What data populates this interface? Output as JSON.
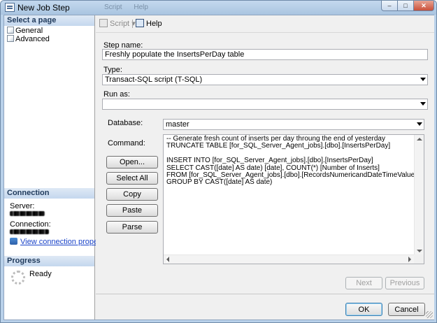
{
  "window": {
    "title": "New Job Step",
    "ghost_tabs": [
      "Script",
      "Help"
    ],
    "min_label": "–",
    "max_label": "□",
    "close_label": "✕"
  },
  "left_pane": {
    "select_page_header": "Select a page",
    "pages": [
      {
        "label": "General",
        "icon": "property-page-icon"
      },
      {
        "label": "Advanced",
        "icon": "property-page-icon"
      }
    ],
    "connection_header": "Connection",
    "server_label": "Server:",
    "connection_label": "Connection:",
    "view_connection_link": "View connection properties",
    "progress_header": "Progress",
    "progress_status": "Ready"
  },
  "toolbar": {
    "script_label": "Script",
    "script_arrow": "▾",
    "help_label": "Help"
  },
  "form": {
    "step_name_label": "Step name:",
    "step_name_value": "Freshly populate the InsertsPerDay table",
    "type_label": "Type:",
    "type_value": "Transact-SQL script (T-SQL)",
    "run_as_label": "Run as:",
    "run_as_value": "",
    "database_label": "Database:",
    "database_value": "master",
    "command_label": "Command:",
    "command_lines": [
      "-- Generate fresh count of inserts per day throung the end of yesterday",
      "TRUNCATE TABLE [for_SQL_Server_Agent_jobs].[dbo].[InsertsPerDay]",
      "",
      "INSERT INTO [for_SQL_Server_Agent_jobs].[dbo].[InsertsPerDay]",
      "SELECT CAST([date] AS date) [date], COUNT(*) [Number of Inserts]",
      "FROM [for_SQL_Server_Agent_jobs].[dbo].[RecordsNumericandDateTimeValues]",
      "GROUP BY CAST([date] AS date)"
    ]
  },
  "command_buttons": {
    "open": "Open...",
    "select_all": "Select All",
    "copy": "Copy",
    "paste": "Paste",
    "parse": "Parse"
  },
  "nav_buttons": {
    "next": "Next",
    "previous": "Previous"
  },
  "dialog_buttons": {
    "ok": "OK",
    "cancel": "Cancel"
  }
}
